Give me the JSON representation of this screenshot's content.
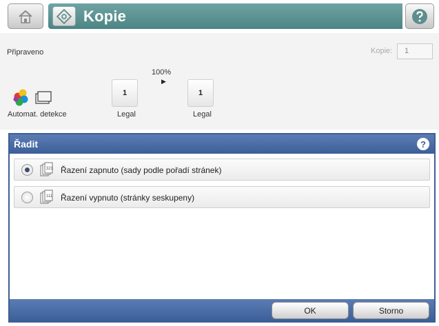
{
  "app": {
    "title": "Kopie"
  },
  "icons": {
    "home": "home-icon",
    "app": "copy-icon",
    "help": "help-icon"
  },
  "status": {
    "ready": "Připraveno",
    "copies_label": "Kopie:",
    "copies_value": "1",
    "color_mode_label": "Automat. detekce",
    "zoom": "100%",
    "source": {
      "pages": "1",
      "paper": "Legal"
    },
    "output": {
      "pages": "1",
      "paper": "Legal"
    }
  },
  "dialog": {
    "title": "Řadit",
    "options": [
      {
        "label": "Řazení zapnuto (sady podle pořadí stránek)",
        "selected": true
      },
      {
        "label": "Řazení vypnuto (stránky seskupeny)",
        "selected": false
      }
    ],
    "ok_label": "OK",
    "cancel_label": "Storno"
  },
  "colors": {
    "title_bar": "#5a9090",
    "dialog_bar": "#4a6ca5"
  }
}
